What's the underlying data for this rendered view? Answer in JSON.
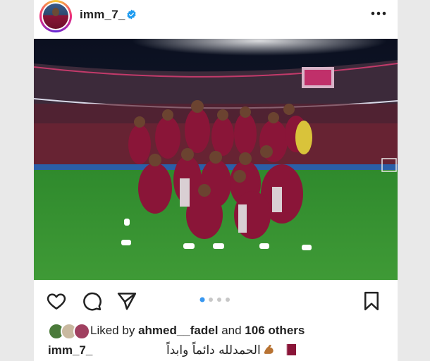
{
  "post": {
    "username": "imm_7_",
    "verified": true,
    "carousel": {
      "count": 4,
      "active_index": 0
    },
    "likes": {
      "prefix": "Liked by",
      "user": "ahmed__fadel",
      "conjunction": "and",
      "others": "106 others"
    },
    "caption": {
      "username": "imm_7_",
      "text": "الحمدلله دائماً وابداً",
      "emojis": [
        "flexed-biceps",
        "qatar-flag"
      ]
    }
  },
  "icons": {
    "like": "heart-icon",
    "comment": "comment-icon",
    "share": "send-icon",
    "save": "bookmark-icon",
    "more": "more-options-icon",
    "verified": "verified-badge-icon"
  },
  "colors": {
    "verified_blue": "#1d9bf0",
    "carousel_active": "#3897f0",
    "carousel_inactive": "#c7c7c7",
    "qatar_maroon": "#8a1538"
  }
}
